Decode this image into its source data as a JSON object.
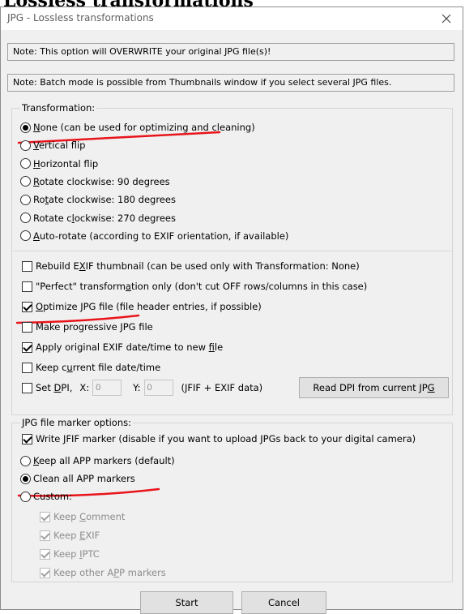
{
  "doc_heading": "Lossless transformations",
  "dialog": {
    "title": "JPG - Lossless transformations",
    "close_glyph": "✕"
  },
  "notes": [
    "Note: This option will OVERWRITE your original JPG file(s)!",
    "Note: Batch mode is possible from Thumbnails window if you select several JPG files."
  ],
  "transformation": {
    "label": "Transformation:",
    "selected": "None",
    "options": [
      {
        "pre": "",
        "u": "N",
        "post": "one (can be used for optimizing and cleaning)",
        "checked": true
      },
      {
        "pre": "",
        "u": "V",
        "post": "ertical flip",
        "checked": false
      },
      {
        "pre": "",
        "u": "H",
        "post": "orizontal flip",
        "checked": false
      },
      {
        "pre": "",
        "u": "R",
        "post": "otate clockwise: 90 degrees",
        "checked": false
      },
      {
        "pre": "Ro",
        "u": "t",
        "post": "ate clockwise: 180 degrees",
        "checked": false
      },
      {
        "pre": "Rotate c",
        "u": "l",
        "post": "ockwise: 270 degrees",
        "checked": false
      },
      {
        "pre": "",
        "u": "A",
        "post": "uto-rotate (according to EXIF orientation, if available)",
        "checked": false
      }
    ]
  },
  "options": [
    {
      "pre": "Rebuild E",
      "u": "X",
      "post": "IF thumbnail (can be used only with Transformation: None)",
      "checked": false
    },
    {
      "pre": "\"Perfect\" transform",
      "u": "a",
      "post": "tion only (don't cut OFF rows/columns in this case)",
      "checked": false
    },
    {
      "pre": "",
      "u": "O",
      "post": "ptimize JPG file (file header entries, if possible)",
      "checked": true
    },
    {
      "pre": "Make progressive JPG file",
      "u": "",
      "post": "",
      "checked": false
    },
    {
      "pre": "Apply original EXIF date/time to new ",
      "u": "f",
      "post": "ile",
      "checked": true
    },
    {
      "pre": "Keep c",
      "u": "u",
      "post": "rrent file date/time",
      "checked": false
    }
  ],
  "dpi": {
    "pre": "Set ",
    "u": "D",
    "post": "PI,",
    "checked": false,
    "x_label": "X:",
    "x_value": "0",
    "y_label": "Y:",
    "y_value": "0",
    "suffix": "(JFIF + EXIF data)",
    "button_pre": "Read DPI from current JP",
    "button_u": "G"
  },
  "markers": {
    "label": "JPG file marker options:",
    "write_jfif": {
      "pre": "Write ",
      "u": "J",
      "post": "FIF marker (disable if you want to upload JPGs back to your digital camera)",
      "checked": true
    },
    "radios": [
      {
        "pre": "",
        "u": "K",
        "post": "eep all APP markers (default)",
        "checked": false
      },
      {
        "pre": "Clean all APP markers",
        "u": "",
        "post": "",
        "checked": true
      },
      {
        "pre": "Custom:",
        "u": "",
        "post": "",
        "checked": false
      }
    ],
    "custom_items": [
      {
        "pre": "Keep ",
        "u": "C",
        "post": "omment",
        "checked": true
      },
      {
        "pre": "Keep ",
        "u": "E",
        "post": "XIF",
        "checked": true
      },
      {
        "pre": "Keep ",
        "u": "I",
        "post": "PTC",
        "checked": true
      },
      {
        "pre": "Keep other A",
        "u": "P",
        "post": "P markers",
        "checked": true
      }
    ]
  },
  "buttons": {
    "start": "Start",
    "cancel": "Cancel"
  },
  "annotation_color": "#e8141b"
}
